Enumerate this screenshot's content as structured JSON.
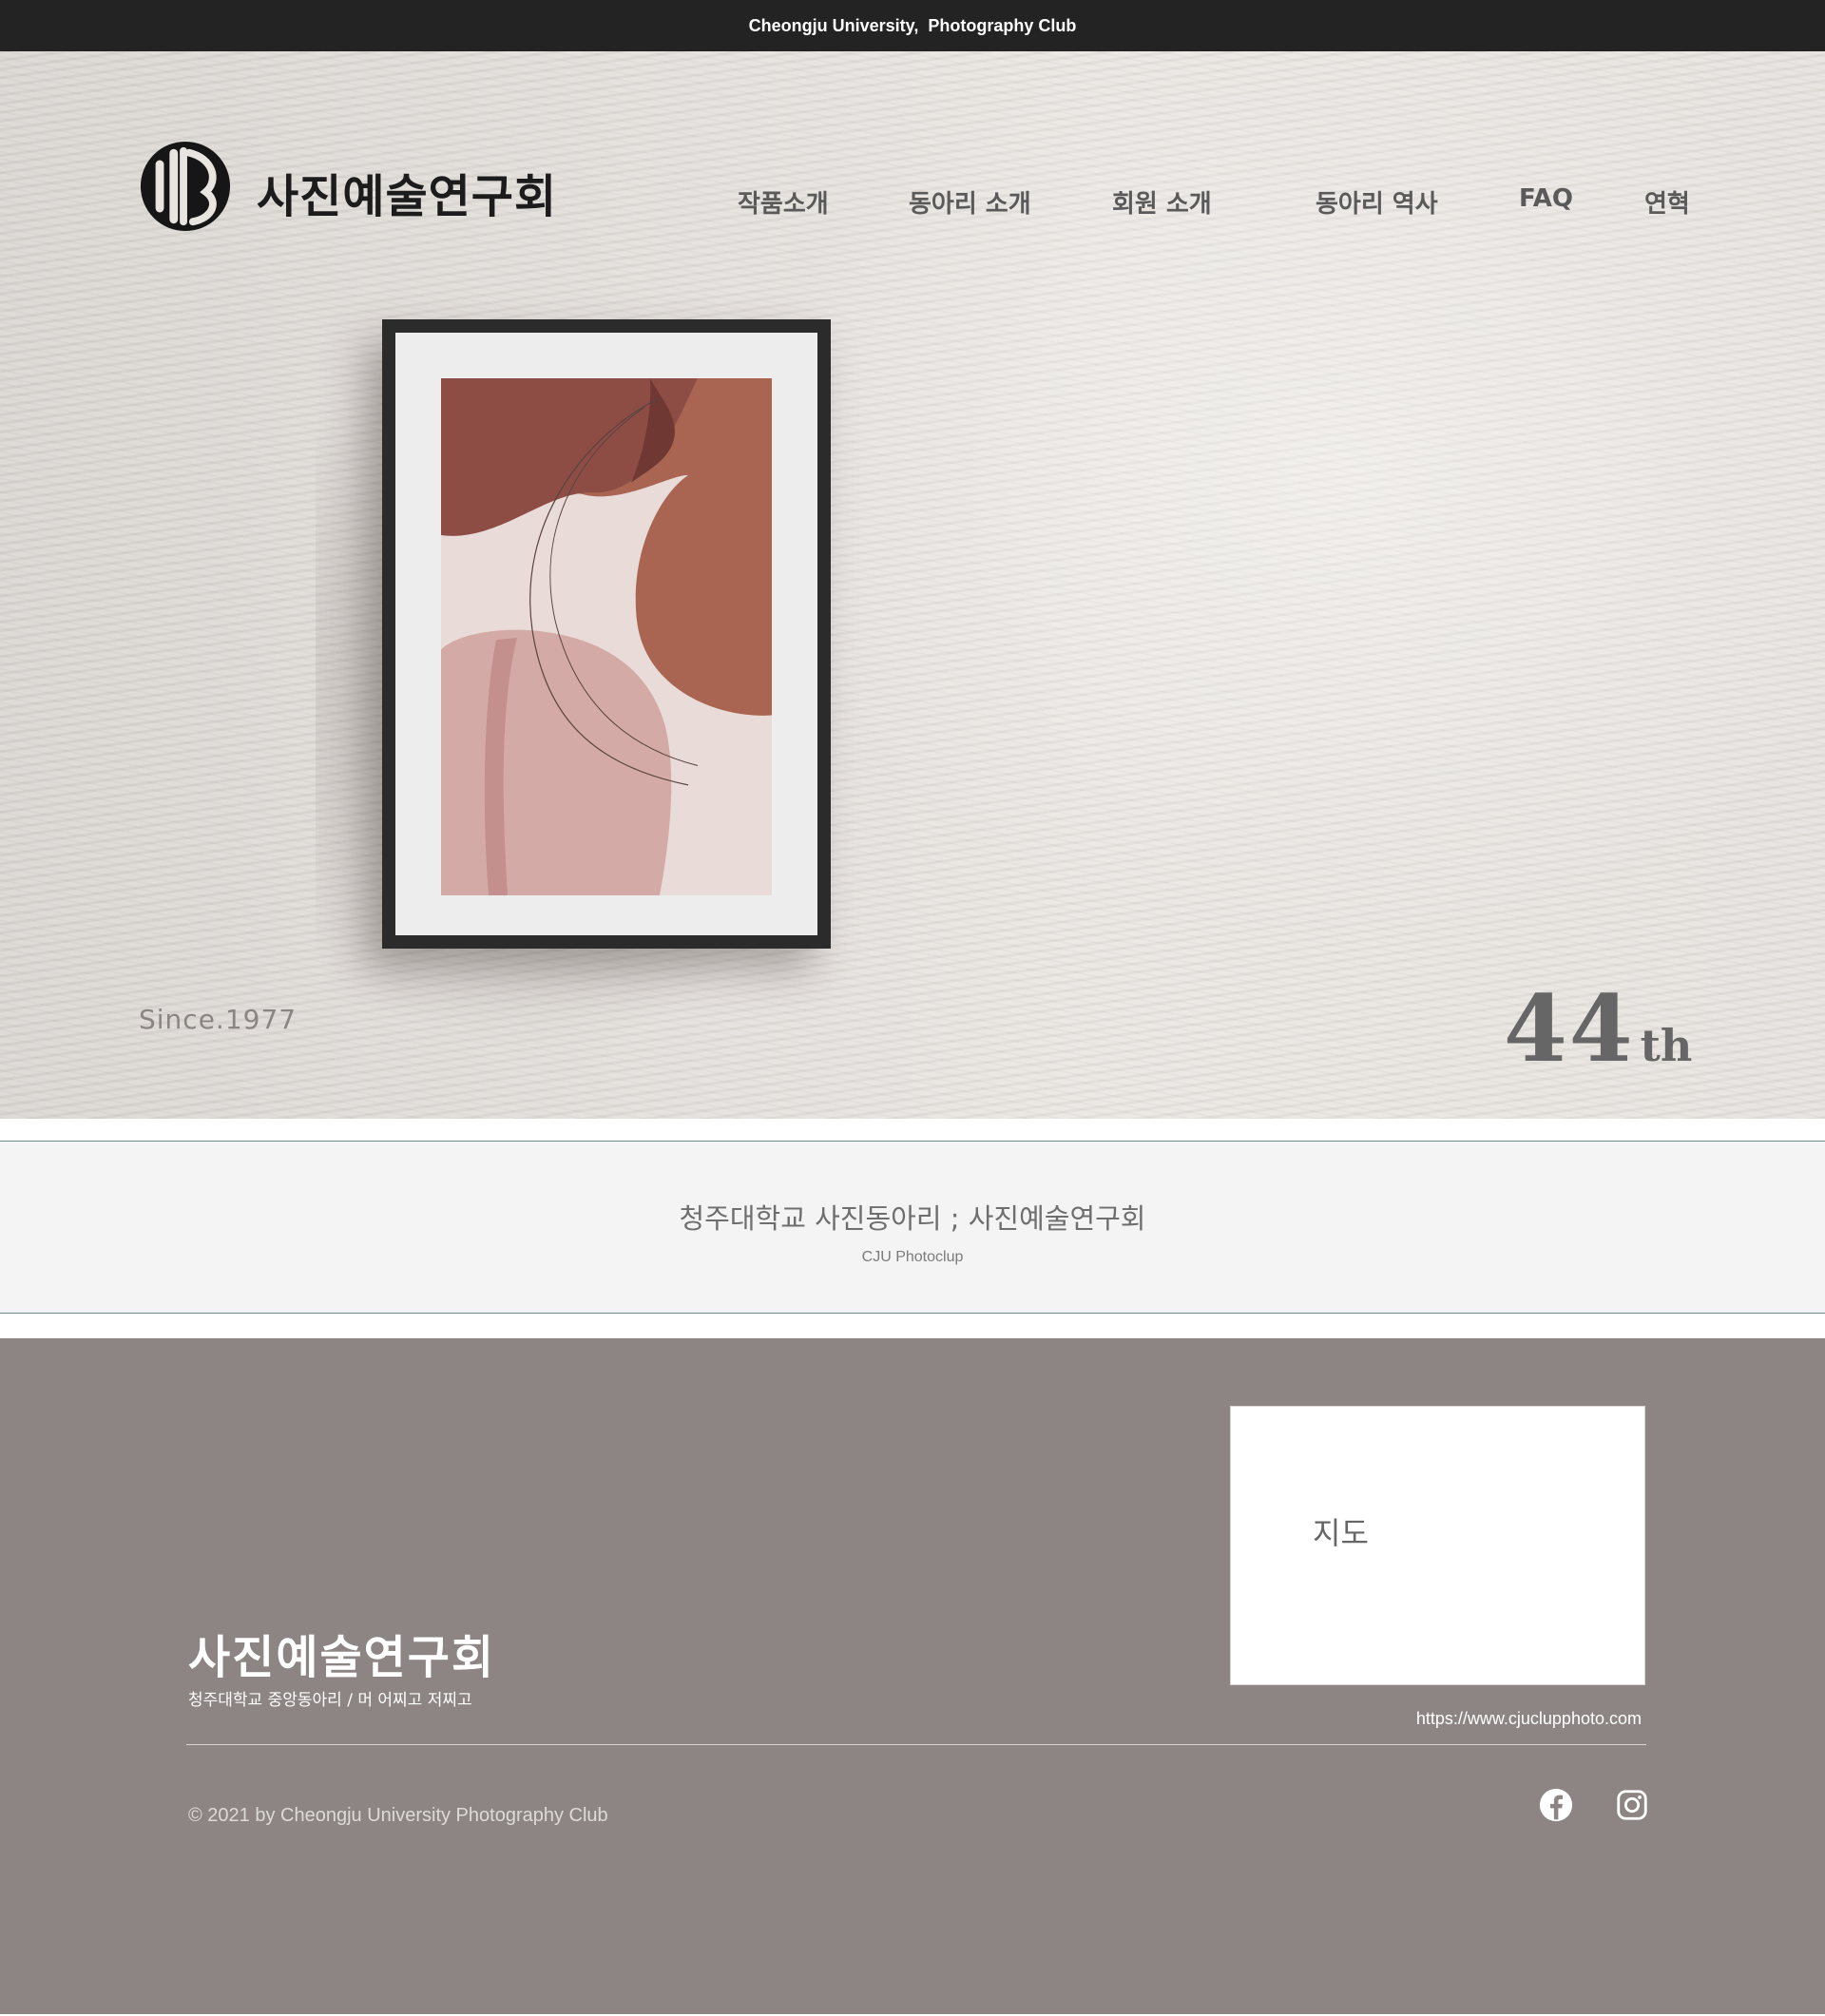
{
  "topbar": {
    "text": "Cheongju University,  Photography Club"
  },
  "header": {
    "logo_text": "사진예술연구회",
    "nav": [
      {
        "label": "작품소개"
      },
      {
        "label": "동아리 소개"
      },
      {
        "label": "회원 소개"
      },
      {
        "label": "동아리 역사"
      },
      {
        "label": "FAQ"
      },
      {
        "label": "연혁"
      }
    ]
  },
  "hero": {
    "since": "Since.1977",
    "edition_number": "44",
    "edition_suffix": "th"
  },
  "intro": {
    "title": "청주대학교 사진동아리 ; 사진예술연구회",
    "subtitle": "CJU Photoclup"
  },
  "footer": {
    "brand": "사진예술연구회",
    "tagline": "청주대학교 중앙동아리 / 머 어찌고 저찌고",
    "map_label": "지도",
    "url": "https://www.cjuclupphoto.com",
    "copyright": "© 2021 by Cheongju University Photography Club",
    "social": [
      {
        "name": "facebook-icon"
      },
      {
        "name": "instagram-icon"
      }
    ]
  },
  "colors": {
    "topbar_bg": "#232323",
    "footer_bg": "#8c8583",
    "intro_bg": "#f4f4f4",
    "accent_line": "#6f8a86"
  }
}
